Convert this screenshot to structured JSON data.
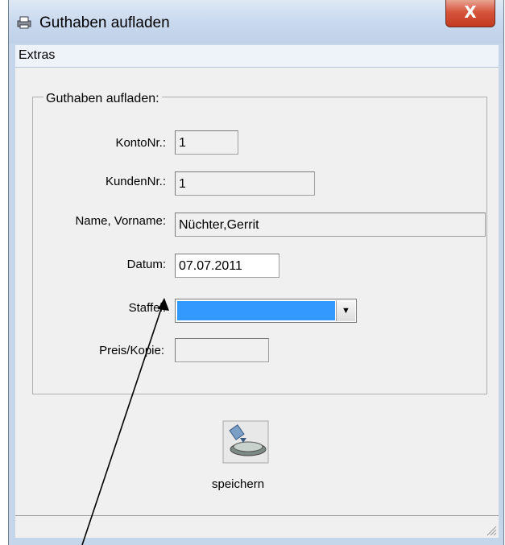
{
  "window": {
    "title": "Guthaben aufladen",
    "close_glyph": "X",
    "title_icon": "app-printer-icon"
  },
  "menu": {
    "items": [
      {
        "label": "Extras"
      }
    ]
  },
  "form": {
    "group_caption": "Guthaben aufladen:",
    "konto_nr": {
      "label": "KontoNr.:",
      "value": "1"
    },
    "kunden_nr": {
      "label": "KundenNr.:",
      "value": "1"
    },
    "name": {
      "label": "Name, Vorname:",
      "value": "Nüchter,Gerrit"
    },
    "datum": {
      "label": "Datum:",
      "value": "07.07.2011"
    },
    "staffel": {
      "label": "Staffel:",
      "value": ""
    },
    "preis": {
      "label": "Preis/Kopie:",
      "value": ""
    }
  },
  "actions": {
    "save_label": "speichern",
    "save_icon": "save-disk-icon"
  },
  "colors": {
    "selection": "#3399ff",
    "close_button": "#c2381d",
    "frame": "#c6d6ea"
  }
}
